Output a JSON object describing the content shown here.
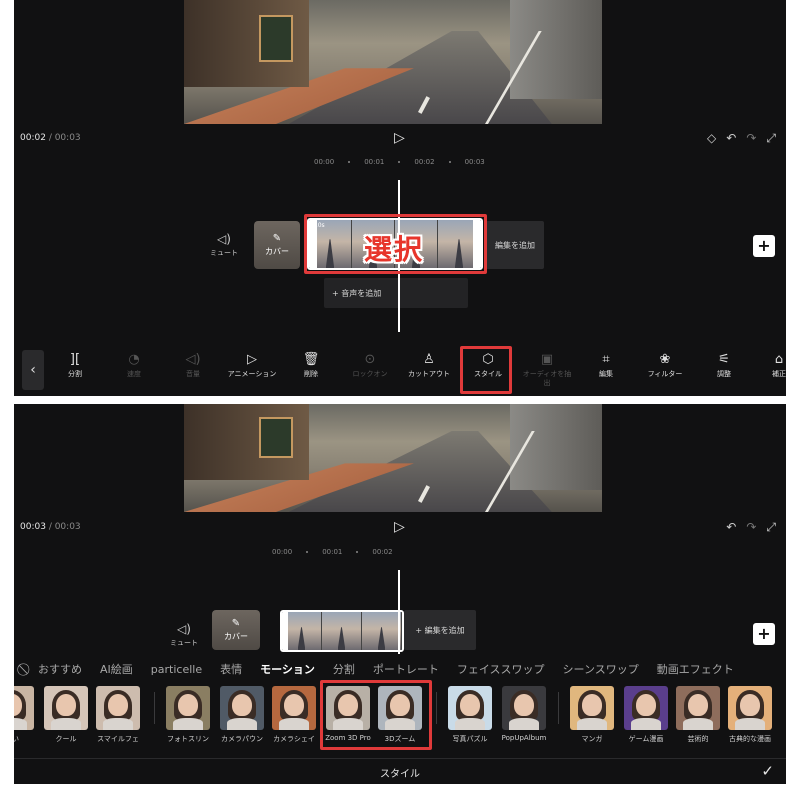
{
  "top": {
    "time_current": "00:02",
    "time_total": "/ 00:03",
    "ruler": [
      "00:00",
      "00:01",
      "00:02",
      "00:03"
    ],
    "mute_label": "ミュート",
    "cover_label": "カバー",
    "clip_length": "3.0s",
    "add_edit_label": "編集を追加",
    "add_audio_label": "+ 音声を追加",
    "annotation": "選択",
    "tools": [
      {
        "icon": "][",
        "label": "分割",
        "enabled": true
      },
      {
        "icon": "◔",
        "label": "速度",
        "enabled": false
      },
      {
        "icon": "◁)",
        "label": "音量",
        "enabled": false
      },
      {
        "icon": "▷",
        "label": "アニメーション",
        "enabled": true
      },
      {
        "icon": "🗑",
        "label": "削除",
        "enabled": true
      },
      {
        "icon": "⊙",
        "label": "ロックオン",
        "enabled": false
      },
      {
        "icon": "♙",
        "label": "カットアウト",
        "enabled": true
      },
      {
        "icon": "⬡",
        "label": "スタイル",
        "enabled": true
      },
      {
        "icon": "▣",
        "label": "オーディオを抽出",
        "enabled": false
      },
      {
        "icon": "⌗",
        "label": "編集",
        "enabled": true
      },
      {
        "icon": "❀",
        "label": "フィルター",
        "enabled": true
      },
      {
        "icon": "⚟",
        "label": "調整",
        "enabled": true
      },
      {
        "icon": "⌂",
        "label": "補正",
        "enabled": true
      }
    ]
  },
  "bottom": {
    "time_current": "00:03",
    "time_total": "/ 00:03",
    "ruler": [
      "00:00",
      "00:01",
      "00:02"
    ],
    "mute_label": "ミュート",
    "cover_label": "カバー",
    "add_edit_label": "+ 編集を追加",
    "categories": [
      "おすすめ",
      "AI絵画",
      "particelle",
      "表情",
      "モーション",
      "分割",
      "ポートレート",
      "フェイススワップ",
      "シーンスワップ",
      "動画エフェクト"
    ],
    "active_category": "モーション",
    "thumbnails": [
      {
        "label": "笑い",
        "bg": "#c9b5a3"
      },
      {
        "label": "クール",
        "bg": "#d5c5b8"
      },
      {
        "label": "スマイルフェ",
        "bg": "#cdbcae"
      },
      {
        "label": "フォトスリン",
        "bg": "#8a7e62"
      },
      {
        "label": "カメラパウン",
        "bg": "#505a66"
      },
      {
        "label": "カメラシェイ",
        "bg": "#b5683f"
      },
      {
        "label": "Zoom 3D Pro",
        "bg": "#b8b0a6"
      },
      {
        "label": "3Dズーム",
        "bg": "#aeb5bd"
      },
      {
        "label": "写真パズル",
        "bg": "#c9dbe8"
      },
      {
        "label": "PopUpAlbum",
        "bg": "#3a3a3e"
      },
      {
        "label": "マンガ",
        "bg": "#e0b77e"
      },
      {
        "label": "ゲーム漫画",
        "bg": "#5a3e8c"
      },
      {
        "label": "芸術的",
        "bg": "#8e6d5c"
      },
      {
        "label": "古典的な漫画",
        "bg": "#e4b07a"
      }
    ],
    "style_title": "スタイル",
    "confirm_icon": "✓"
  }
}
